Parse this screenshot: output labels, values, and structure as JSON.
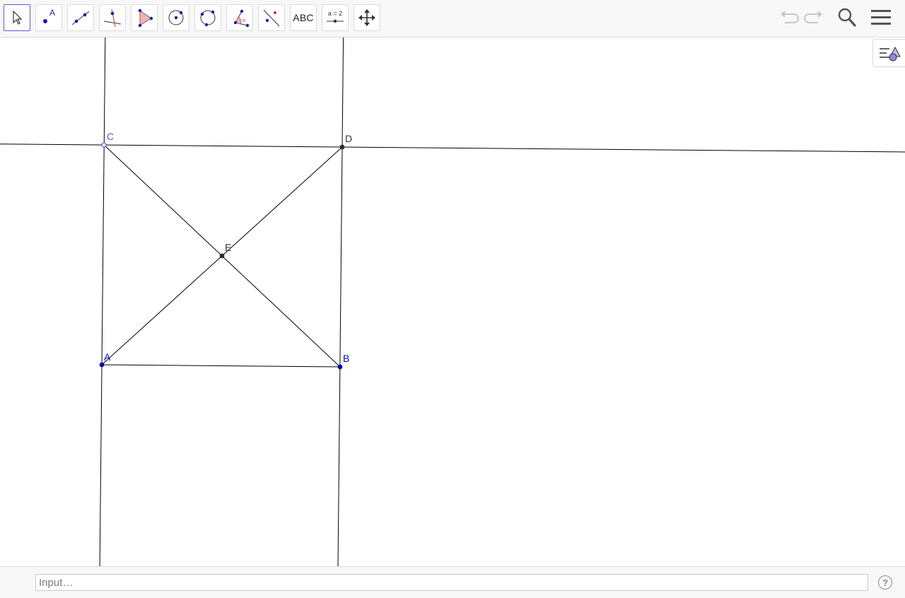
{
  "toolbar": {
    "tools": [
      {
        "id": "move",
        "icon": "arrow-cursor-icon",
        "active": true
      },
      {
        "id": "point",
        "icon": "point-icon",
        "label": "A"
      },
      {
        "id": "line",
        "icon": "line-through-points-icon"
      },
      {
        "id": "perpendicular",
        "icon": "perpendicular-line-icon"
      },
      {
        "id": "polygon",
        "icon": "polygon-icon"
      },
      {
        "id": "circle",
        "icon": "circle-center-point-icon"
      },
      {
        "id": "conic",
        "icon": "circle-three-points-icon"
      },
      {
        "id": "angle",
        "icon": "angle-icon"
      },
      {
        "id": "reflect",
        "icon": "reflect-about-line-icon"
      },
      {
        "id": "text",
        "icon": "text-icon",
        "label": "ABC"
      },
      {
        "id": "slider",
        "icon": "slider-icon",
        "label": "a = 2"
      },
      {
        "id": "move-graphics",
        "icon": "move-graphics-view-icon"
      }
    ],
    "right": [
      "undo-icon",
      "redo-icon",
      "search-icon",
      "menu-icon"
    ]
  },
  "graphics": {
    "points": [
      {
        "name": "A",
        "color": "#0000cc"
      },
      {
        "name": "B",
        "color": "#0000cc"
      },
      {
        "name": "C",
        "color": "#5b5bd6"
      },
      {
        "name": "D",
        "color": "#333333"
      },
      {
        "name": "E",
        "color": "#333333"
      }
    ],
    "colors": {
      "line": "#000000",
      "accent": "#6557d2"
    }
  },
  "input_bar": {
    "placeholder": "Input…",
    "help": "?"
  }
}
